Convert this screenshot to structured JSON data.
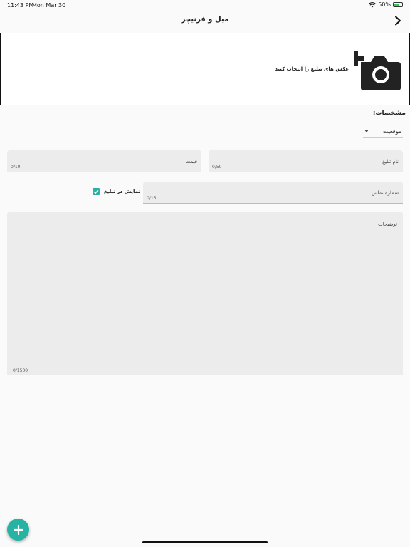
{
  "status_bar": {
    "time": "11:43 PM",
    "date": "Mon Mar 30",
    "battery": "50%"
  },
  "header": {
    "title": "مبل و فرنیچر",
    "back_icon": "chevron-right-icon"
  },
  "photo_picker": {
    "hint": "عکس های تبلیغ را انتخاب کنید",
    "icon": "add-camera-icon"
  },
  "specs": {
    "title": "مشخصات:",
    "location_dropdown": {
      "label": "موقعیت"
    }
  },
  "form": {
    "ad_name": {
      "label": "نام تبلیغ",
      "counter": "0/50"
    },
    "price": {
      "label": "قیمت",
      "counter": "0/10"
    },
    "phone": {
      "label": "شماره تماس",
      "counter": "0/15"
    },
    "show_in_ad": {
      "label": "نمایش در تبلیغ",
      "checked": true
    },
    "description": {
      "label": "توضیحات",
      "counter": "0/1500"
    }
  },
  "colors": {
    "accent": "#26b3a3",
    "field_bg": "#ececec",
    "background": "#fafafa"
  },
  "fab": {
    "icon": "plus-icon"
  }
}
